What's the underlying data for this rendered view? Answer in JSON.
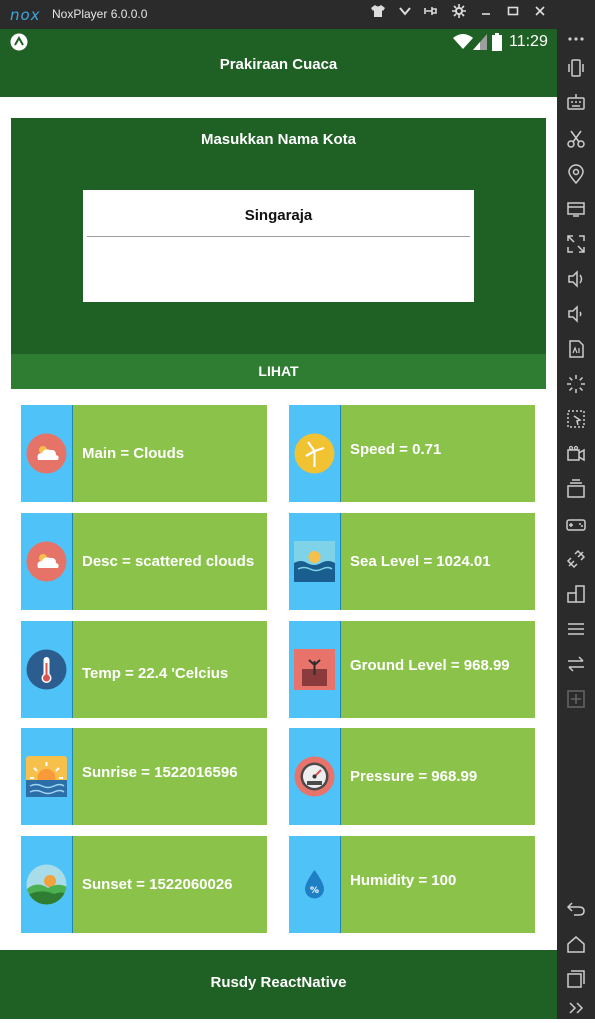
{
  "emulator": {
    "logo_text": "nox",
    "window_title": "NoxPlayer 6.0.0.0"
  },
  "status_bar": {
    "time": "11:29"
  },
  "app": {
    "title": "Prakiraan Cuaca"
  },
  "search": {
    "heading": "Masukkan Nama Kota",
    "city_value": "Singaraja",
    "button_label": "LIHAT"
  },
  "cards": [
    {
      "icon": "cloud-sun-icon",
      "label": "Main = Clouds"
    },
    {
      "icon": "wind-turbine-icon",
      "label": "Speed = 0.71"
    },
    {
      "icon": "cloud-sun-icon",
      "label": "Desc = scattered clouds"
    },
    {
      "icon": "sea-wave-icon",
      "label": "Sea Level = 1024.01"
    },
    {
      "icon": "thermometer-icon",
      "label": "Temp = 22.4 'Celcius"
    },
    {
      "icon": "ground-sprout-icon",
      "label": "Ground Level = 968.99"
    },
    {
      "icon": "sunrise-icon",
      "label": "Sunrise = 1522016596"
    },
    {
      "icon": "pressure-gauge-icon",
      "label": "Pressure = 968.99"
    },
    {
      "icon": "sunset-hills-icon",
      "label": "Sunset = 1522060026"
    },
    {
      "icon": "humidity-drop-icon",
      "label": "Humidity = 100"
    }
  ],
  "footer": {
    "text": "Rusdy ReactNative"
  },
  "colors": {
    "app_green": "#1f6024",
    "button_green": "#2e7d32",
    "card_green": "#8bc34a",
    "card_strip_blue": "#4fc3f7",
    "emulator_frame": "#2b2b2b"
  }
}
